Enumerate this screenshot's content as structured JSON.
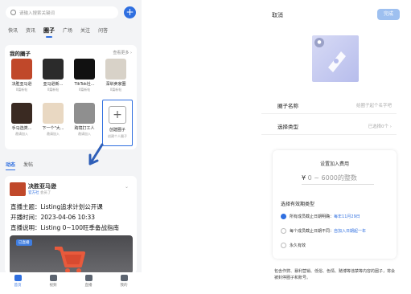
{
  "search": {
    "placeholder": "请输入搜索关键词"
  },
  "plus_label": "+",
  "tabs": [
    "快讯",
    "资讯",
    "圈子",
    "广场",
    "关注",
    "问答"
  ],
  "my_circles": {
    "title": "我的圈子",
    "more": "查看更多 ›",
    "items": [
      {
        "name": "决胜亚马逊",
        "sub": "0篇新帖",
        "color": "#c0482a"
      },
      {
        "name": "亚马逊新...",
        "sub": "0篇新帖",
        "color": "#2b2b2b"
      },
      {
        "name": "TikTok社...",
        "sub": "0篇新帖",
        "color": "#111111"
      },
      {
        "name": "深圳卖家圈",
        "sub": "0篇新帖",
        "color": "#d8d2c8"
      },
      {
        "name": "手马选类...",
        "sub": "邀请加入",
        "color": "#3a2a22"
      },
      {
        "name": "下一个\"大...",
        "sub": "邀请加入",
        "color": "#e9d8c2"
      },
      {
        "name": "跨境打工人",
        "sub": "邀请加入",
        "color": "#8f8f8f"
      }
    ],
    "create": {
      "icon": "+",
      "name": "创建圈子",
      "sub": "创建个人圈子"
    }
  },
  "feed_tabs": {
    "active": "动态",
    "other": "发帖"
  },
  "post": {
    "name": "决胜亚马逊",
    "tag": "官方社",
    "meta": "会员了",
    "lines": [
      "直播主题：Listing追求计划公开课",
      "开播时间：2023-04-06 10:33",
      "直播说明：Listing 0~100旺季备战指南"
    ],
    "live_label": "已直播"
  },
  "nav": [
    {
      "label": "首页",
      "active": true
    },
    {
      "label": "视频",
      "active": false
    },
    {
      "label": "直播",
      "active": false
    },
    {
      "label": "我的",
      "active": false
    }
  ],
  "editor": {
    "cancel": "取消",
    "done": "完成",
    "name_label": "圈子名称",
    "name_placeholder": "给圈子起个名字吧",
    "type_label": "选择类型",
    "type_value": "已选择0个 ›",
    "fee_title": "设置加入费用",
    "fee_currency": "¥",
    "fee_range": "0 ~ 6000的整数",
    "validity_title": "选择有效期类型",
    "options": [
      {
        "key": "所有成员截止日期明确",
        "desc": "每年11月29日",
        "selected": true
      },
      {
        "key": "每个成员截止日期不同",
        "desc": "自加入日期起一年",
        "selected": false
      },
      {
        "key": "永久有效",
        "desc": "",
        "selected": false
      }
    ],
    "note": "包含作弊、暴利营销、低俗、色情、赌博等违禁等内容的圈子，将会被封停圈子和账号。"
  }
}
